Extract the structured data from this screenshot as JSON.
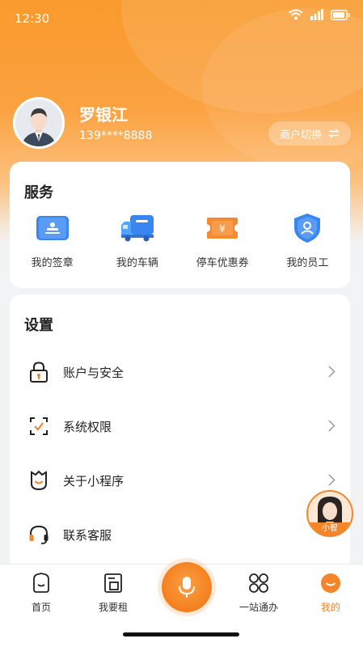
{
  "status_bar": {
    "time": "12:30",
    "icons": [
      "wifi-icon",
      "signal-icon",
      "battery-icon"
    ]
  },
  "profile": {
    "name": "罗银江",
    "phone": "139****8888",
    "switch_label": "商户切换",
    "switch_icon": "swap-icon"
  },
  "services": {
    "title": "服务",
    "items": [
      {
        "label": "我的签章",
        "icon": "seal-icon"
      },
      {
        "label": "我的车辆",
        "icon": "truck-icon"
      },
      {
        "label": "停车优惠券",
        "icon": "coupon-icon"
      },
      {
        "label": "我的员工",
        "icon": "staff-shield-icon"
      }
    ]
  },
  "settings": {
    "title": "设置",
    "items": [
      {
        "label": "账户与安全",
        "icon": "lock-icon"
      },
      {
        "label": "系统权限",
        "icon": "permission-check-icon"
      },
      {
        "label": "关于小程序",
        "icon": "smile-badge-icon"
      },
      {
        "label": "联系客服",
        "icon": "headset-icon"
      }
    ]
  },
  "assistant": {
    "label": "小智"
  },
  "tabbar": {
    "items": [
      {
        "label": "首页",
        "icon": "home-icon"
      },
      {
        "label": "我要租",
        "icon": "rent-icon"
      },
      {
        "label": "",
        "icon": "microphone-icon"
      },
      {
        "label": "一站通办",
        "icon": "grid-apps-icon"
      },
      {
        "label": "我的",
        "icon": "profile-smile-icon"
      }
    ]
  },
  "colors": {
    "accent": "#f6852a",
    "blue": "#3a86f0",
    "text": "#222222"
  }
}
